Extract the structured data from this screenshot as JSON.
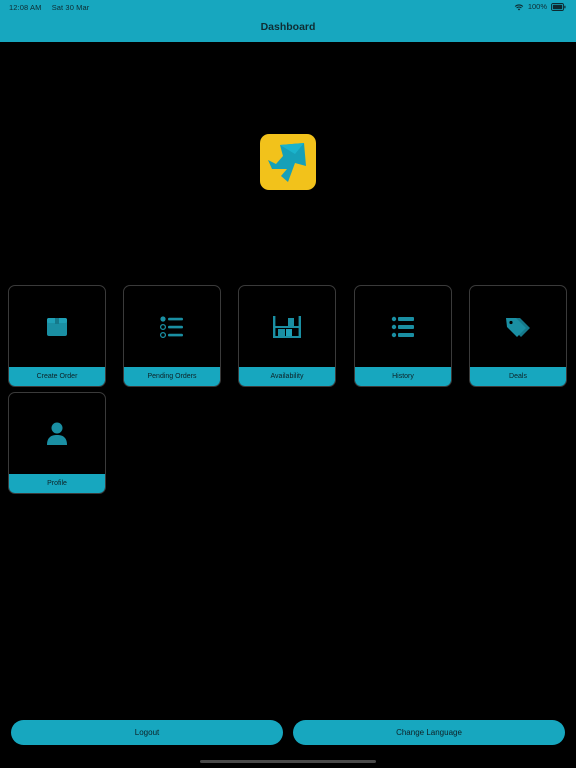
{
  "status_bar": {
    "time": "12:08 AM",
    "date": "Sat 30 Mar",
    "battery": "100%",
    "icons": [
      "wifi-icon",
      "battery-icon"
    ]
  },
  "header": {
    "title": "Dashboard"
  },
  "logo": {
    "icon": "arrow-logo-icon"
  },
  "tiles": [
    {
      "label": "Create Order",
      "icon": "box-icon"
    },
    {
      "label": "Pending Orders",
      "icon": "list-icon"
    },
    {
      "label": "Availability",
      "icon": "shelf-icon"
    },
    {
      "label": "History",
      "icon": "history-list-icon"
    },
    {
      "label": "Deals",
      "icon": "tags-icon"
    },
    {
      "label": "Profile",
      "icon": "person-icon"
    }
  ],
  "footer": {
    "logout_label": "Logout",
    "language_label": "Change Language"
  },
  "colors": {
    "accent": "#17a7bf",
    "icon": "#1a8fa3",
    "logo_bg": "#f2c21b",
    "background": "#000000"
  }
}
